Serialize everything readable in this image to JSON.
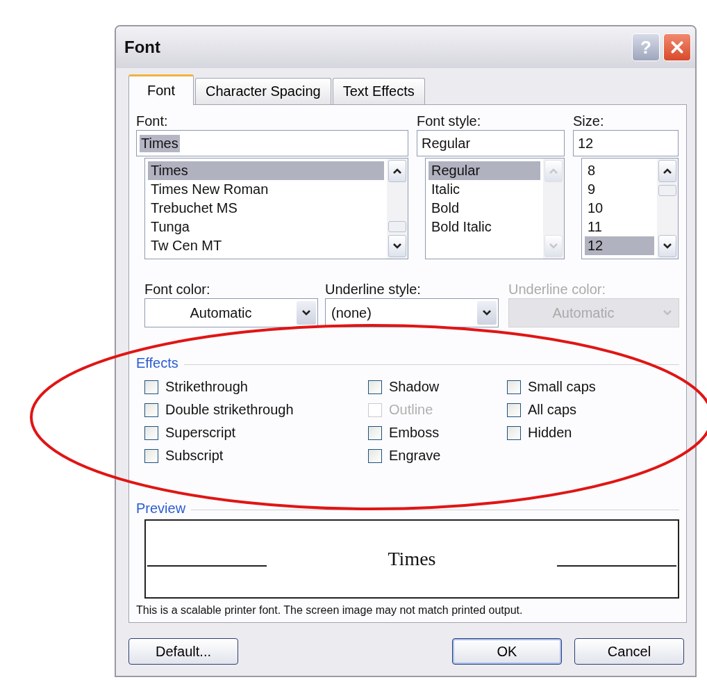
{
  "window": {
    "title": "Font",
    "help_button": "?"
  },
  "tabs": [
    {
      "label": "Font",
      "selected": true
    },
    {
      "label": "Character Spacing",
      "selected": false
    },
    {
      "label": "Text Effects",
      "selected": false
    }
  ],
  "font": {
    "label": "Font:",
    "value": "Times",
    "value_highlighted": true,
    "scroll_disabled": false,
    "items": [
      {
        "label": "Times",
        "selected": true
      },
      {
        "label": "Times New Roman",
        "selected": false
      },
      {
        "label": "Trebuchet MS",
        "selected": false
      },
      {
        "label": "Tunga",
        "selected": false
      },
      {
        "label": "Tw Cen MT",
        "selected": false
      }
    ]
  },
  "font_style": {
    "label": "Font style:",
    "value": "Regular",
    "value_highlighted": false,
    "scroll_disabled": true,
    "items": [
      {
        "label": "Regular",
        "selected": true
      },
      {
        "label": "Italic",
        "selected": false
      },
      {
        "label": "Bold",
        "selected": false
      },
      {
        "label": "Bold Italic",
        "selected": false
      }
    ]
  },
  "size": {
    "label": "Size:",
    "value": "12",
    "value_highlighted": false,
    "scroll_disabled": false,
    "items": [
      {
        "label": "8",
        "selected": false
      },
      {
        "label": "9",
        "selected": false
      },
      {
        "label": "10",
        "selected": false
      },
      {
        "label": "11",
        "selected": false
      },
      {
        "label": "12",
        "selected": true
      }
    ]
  },
  "combos": [
    {
      "label": "Font color:",
      "value": "Automatic",
      "kind": "color",
      "disabled": false
    },
    {
      "label": "Underline style:",
      "value": "(none)",
      "kind": "style",
      "disabled": false
    },
    {
      "label": "Underline color:",
      "value": "Automatic",
      "kind": "color",
      "disabled": true
    }
  ],
  "effects": {
    "title": "Effects",
    "columns": [
      [
        {
          "label": "Strikethrough",
          "checked": false,
          "disabled": false
        },
        {
          "label": "Double strikethrough",
          "checked": false,
          "disabled": false
        },
        {
          "label": "Superscript",
          "checked": false,
          "disabled": false
        },
        {
          "label": "Subscript",
          "checked": false,
          "disabled": false
        }
      ],
      [
        {
          "label": "Shadow",
          "checked": false,
          "disabled": false
        },
        {
          "label": "Outline",
          "checked": false,
          "disabled": true
        },
        {
          "label": "Emboss",
          "checked": false,
          "disabled": false
        },
        {
          "label": "Engrave",
          "checked": false,
          "disabled": false
        }
      ],
      [
        {
          "label": "Small caps",
          "checked": false,
          "disabled": false
        },
        {
          "label": "All caps",
          "checked": false,
          "disabled": false
        },
        {
          "label": "Hidden",
          "checked": false,
          "disabled": false
        }
      ]
    ]
  },
  "preview": {
    "title": "Preview",
    "sample": "Times",
    "note": "This is a scalable printer font. The screen image may not match printed output."
  },
  "buttons": [
    {
      "label": "Default...",
      "default": false
    },
    {
      "label": "OK",
      "default": true
    },
    {
      "label": "Cancel",
      "default": false
    }
  ],
  "annotation": {
    "kind": "ellipse"
  }
}
